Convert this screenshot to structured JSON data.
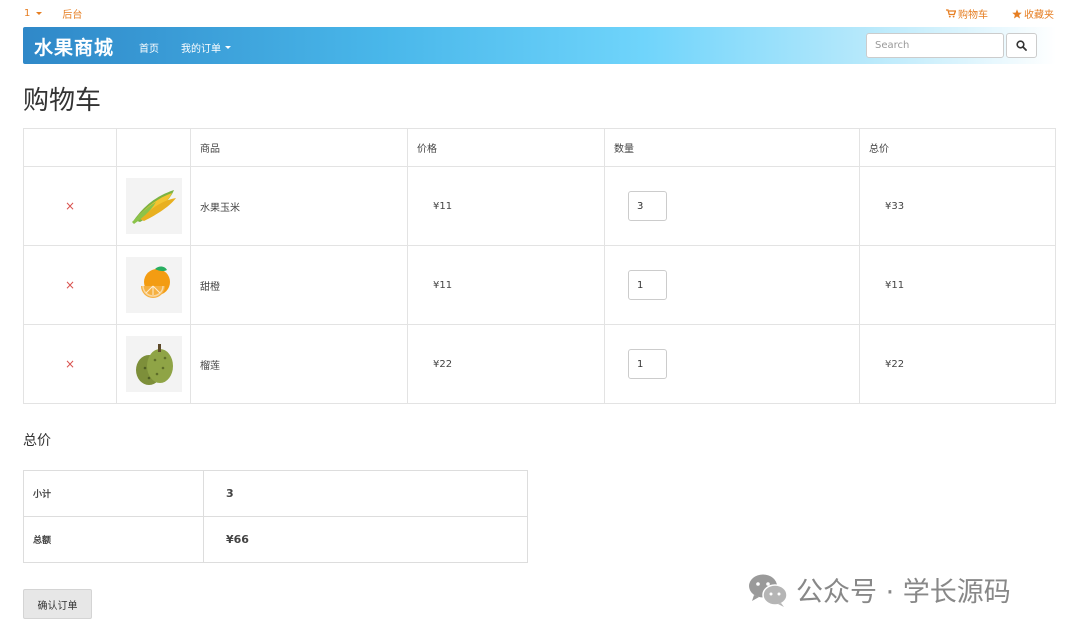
{
  "topbar": {
    "user_label": "1",
    "admin_label": "后台",
    "cart_label": "购物车",
    "favorites_label": "收藏夹"
  },
  "navbar": {
    "brand": "水果商城",
    "home": "首页",
    "orders": "我的订单",
    "search_placeholder": "Search"
  },
  "page_title": "购物车",
  "cart": {
    "headers": [
      "",
      "",
      "商品",
      "价格",
      "数量",
      "总价"
    ],
    "items": [
      {
        "name": "水果玉米",
        "price": "¥11",
        "quantity": "3",
        "total": "¥33",
        "image_icon": "corn-image"
      },
      {
        "name": "甜橙",
        "price": "¥11",
        "quantity": "1",
        "total": "¥11",
        "image_icon": "orange-image"
      },
      {
        "name": "榴莲",
        "price": "¥22",
        "quantity": "1",
        "total": "¥22",
        "image_icon": "durian-image"
      }
    ],
    "remove_symbol": "×"
  },
  "summary": {
    "heading": "总价",
    "subtotal_label": "小计",
    "subtotal_value": "3",
    "amount_label": "总额",
    "amount_value": "¥66"
  },
  "confirm_button": "确认订单",
  "watermark": "公众号 · 学长源码",
  "colors": {
    "accent_orange": "#e67e22",
    "remove_red": "#d9534f",
    "navbar_start": "#2f88c8",
    "navbar_mid": "#6fd4fb"
  }
}
